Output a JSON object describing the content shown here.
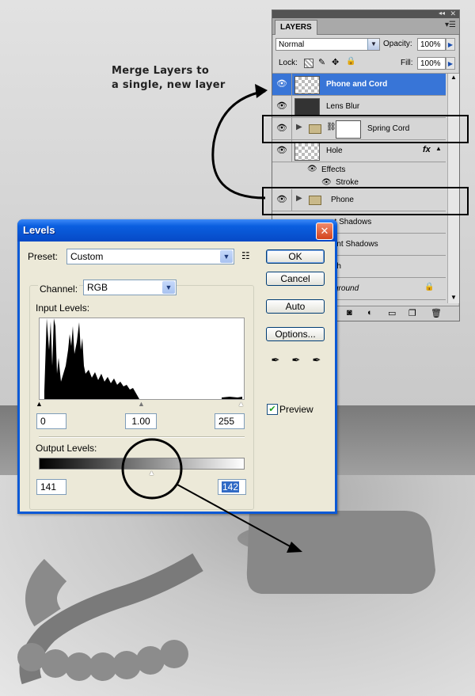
{
  "annotation": {
    "line1": "Merge Layers to",
    "line2": "a single, new layer"
  },
  "layers_panel": {
    "tab": "LAYERS",
    "panel_menu_icon": "panel-menu-icon",
    "blend_mode": "Normal",
    "opacity_label": "Opacity:",
    "opacity_value": "100%",
    "lock_label": "Lock:",
    "fill_label": "Fill:",
    "fill_value": "100%",
    "layers": [
      {
        "name": "Phone and Cord",
        "selected": true
      },
      {
        "name": "Lens Blur"
      },
      {
        "name": "Spring Cord",
        "group": true
      },
      {
        "name": "Hole",
        "fx": "fx"
      },
      {
        "name": "Effects"
      },
      {
        "name": "Stroke"
      },
      {
        "name": "Phone",
        "group": true
      },
      {
        "name": "ect Shadows"
      },
      {
        "name": "bient Shadows"
      },
      {
        "name": "etch"
      },
      {
        "name": "ckground"
      }
    ]
  },
  "levels": {
    "title": "Levels",
    "preset_label": "Preset:",
    "preset_value": "Custom",
    "channel_label": "Channel:",
    "channel_value": "RGB",
    "input_levels_label": "Input Levels:",
    "input_black": "0",
    "input_gamma": "1.00",
    "input_white": "255",
    "output_levels_label": "Output Levels:",
    "output_black": "141",
    "output_white": "142",
    "ok": "OK",
    "cancel": "Cancel",
    "auto": "Auto",
    "options": "Options...",
    "preview_label": "Preview",
    "preview_checked": true
  }
}
